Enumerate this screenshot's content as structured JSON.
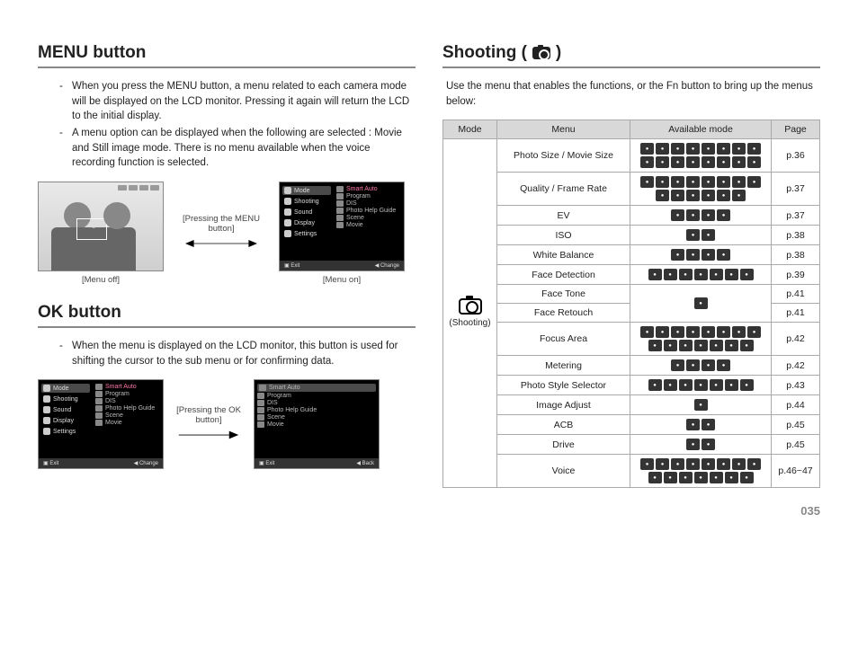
{
  "left": {
    "menu_title": "MENU button",
    "menu_p1a": "When you press the MENU button, a menu related to each camera mode will be displayed on the LCD monitor. Pressing it again will return the LCD to the initial display.",
    "menu_p1b": "A menu option can be displayed when the following are selected : Movie and Still image mode. There is no menu available when the voice recording function is selected.",
    "menu_mid_caption": "[Pressing the MENU button]",
    "menu_off": "[Menu off]",
    "menu_on": "[Menu on]",
    "ok_title": "OK button",
    "ok_p1": "When the menu is displayed on the LCD monitor, this button is used for shifting the cursor to the sub menu or for confirming data.",
    "ok_mid_caption": "[Pressing the OK button]",
    "lcd_menu_items": [
      "Mode",
      "Shooting",
      "Sound",
      "Display",
      "Settings"
    ],
    "lcd_list_items": [
      "Smart Auto",
      "Program",
      "DIS",
      "Photo Help Guide",
      "Scene",
      "Movie"
    ],
    "lcd_exit": "Exit",
    "lcd_change": "Change",
    "lcd_back": "Back"
  },
  "right": {
    "title_a": "Shooting (",
    "title_b": ")",
    "intro": "Use the menu that enables the functions, or the Fn button to bring up the menus below:",
    "th_mode": "Mode",
    "th_menu": "Menu",
    "th_avail": "Available mode",
    "th_page": "Page",
    "mode_label": "(Shooting)",
    "rows": [
      {
        "menu": "Photo Size / Movie Size",
        "icons": 16,
        "page": "p.36"
      },
      {
        "menu": "Quality / Frame Rate",
        "icons": 14,
        "page": "p.37"
      },
      {
        "menu": "EV",
        "icons": 4,
        "page": "p.37"
      },
      {
        "menu": "ISO",
        "icons": 2,
        "page": "p.38"
      },
      {
        "menu": "White Balance",
        "icons": 4,
        "page": "p.38"
      },
      {
        "menu": "Face Detection",
        "icons": 7,
        "page": "p.39"
      },
      {
        "menu": "Face Tone",
        "icons": 1,
        "page": "p.41",
        "share_icons": true
      },
      {
        "menu": "Face Retouch",
        "icons": 0,
        "page": "p.41",
        "share_bottom": true
      },
      {
        "menu": "Focus Area",
        "icons": 15,
        "page": "p.42"
      },
      {
        "menu": "Metering",
        "icons": 4,
        "page": "p.42"
      },
      {
        "menu": "Photo Style Selector",
        "icons": 7,
        "page": "p.43"
      },
      {
        "menu": "Image Adjust",
        "icons": 1,
        "page": "p.44"
      },
      {
        "menu": "ACB",
        "icons": 2,
        "page": "p.45"
      },
      {
        "menu": "Drive",
        "icons": 2,
        "page": "p.45"
      },
      {
        "menu": "Voice",
        "icons": 15,
        "page": "p.46~47"
      }
    ]
  },
  "page_number": "035"
}
